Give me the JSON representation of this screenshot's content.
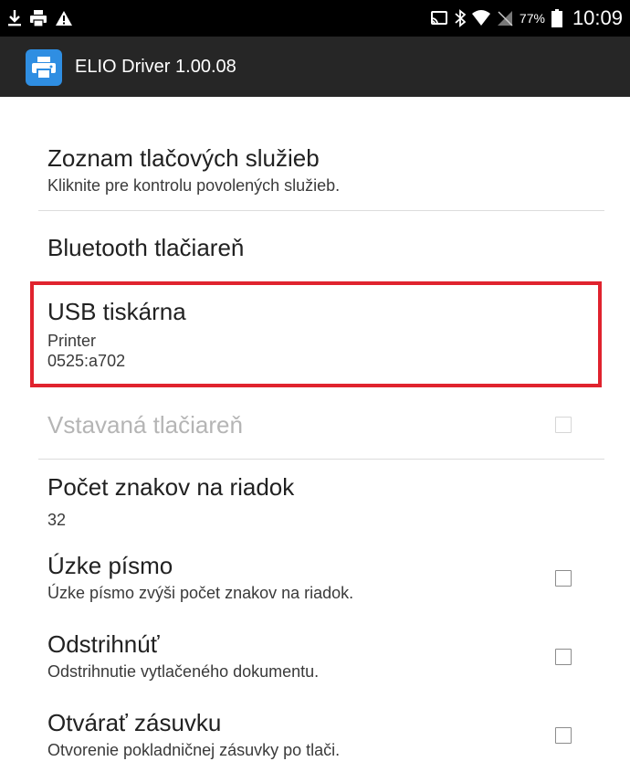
{
  "status_bar": {
    "battery_percent": "77%",
    "time": "10:09",
    "left_icons": [
      "download-icon",
      "print-icon",
      "warning-icon"
    ],
    "right_icons": [
      "cast-icon",
      "bluetooth-icon",
      "wifi-icon",
      "no-signal-icon",
      "battery-icon"
    ]
  },
  "app_bar": {
    "title": "ELIO Driver 1.00.08",
    "icon": "printer-icon",
    "icon_color": "#2f8ee2"
  },
  "preferences": [
    {
      "title": "Zoznam tlačových služieb",
      "summary": "Kliknite pre kontrolu povolených služieb."
    },
    {
      "title": "Bluetooth tlačiareň"
    },
    {
      "title": "USB tiskárna",
      "summary_line1": "Printer",
      "summary_line2": "0525:a702",
      "highlighted": true
    },
    {
      "title": "Vstavaná tlačiareň",
      "enabled": false,
      "checked": false
    },
    {
      "title": "Počet znakov na riadok",
      "summary": "32"
    },
    {
      "title": "Úzke písmo",
      "summary": "Úzke písmo zvýši počet znakov na riadok.",
      "checked": false
    },
    {
      "title": "Odstrihnúť",
      "summary": "Odstrihnutie vytlačeného dokumentu.",
      "checked": false
    },
    {
      "title": "Otvárať zásuvku",
      "summary": "Otvorenie pokladničnej zásuvky po tlači.",
      "checked": false
    }
  ],
  "colors": {
    "highlight_border": "#e0232e",
    "app_bar_bg": "#262626",
    "status_bar_bg": "#000000"
  }
}
